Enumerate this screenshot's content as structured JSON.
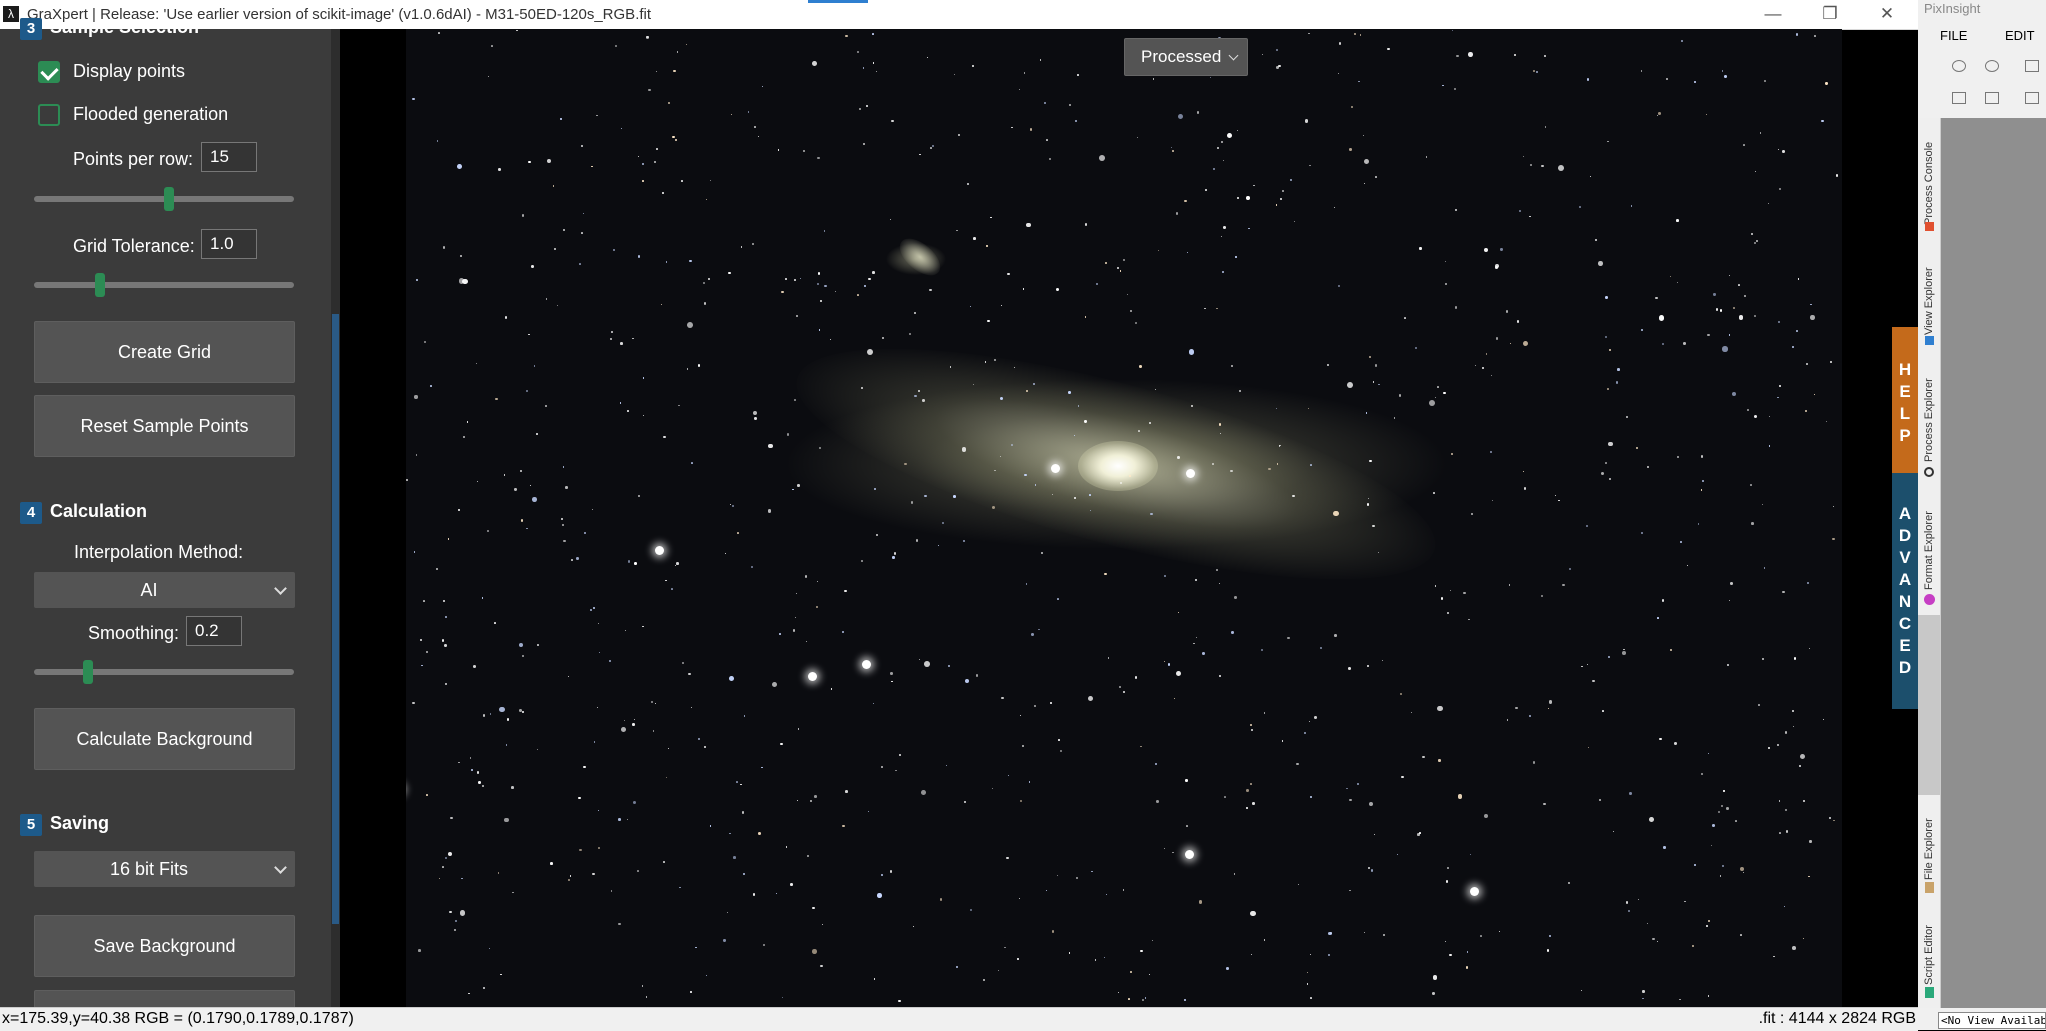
{
  "titlebar": {
    "title": "GraXpert | Release: 'Use earlier version of scikit-image' (v1.0.6dAI) - M31-50ED-120s_RGB.fit",
    "minimize": "—",
    "maximize": "❐",
    "close": "✕"
  },
  "sample_selection": {
    "section_number": "3",
    "title": "Sample Selection",
    "display_points_label": "Display points",
    "display_points_checked": true,
    "flooded_generation_label": "Flooded generation",
    "flooded_generation_checked": false,
    "points_per_row_label": "Points per row:",
    "points_per_row_value": "15",
    "grid_tolerance_label": "Grid Tolerance:",
    "grid_tolerance_value": "1.0",
    "create_grid_label": "Create Grid",
    "reset_label": "Reset Sample Points"
  },
  "calculation": {
    "section_number": "4",
    "title": "Calculation",
    "interpolation_label": "Interpolation Method:",
    "interpolation_value": "AI",
    "smoothing_label": "Smoothing:",
    "smoothing_value": "0.2",
    "calculate_label": "Calculate Background"
  },
  "saving": {
    "section_number": "5",
    "title": "Saving",
    "format_value": "16 bit Fits",
    "save_label": "Save Background"
  },
  "image": {
    "view_mode": "Processed"
  },
  "side_tabs": {
    "help": "HELP",
    "advanced": "ADVANCED"
  },
  "pixinsight": {
    "title": "PixInsight",
    "menu_file": "FILE",
    "menu_edit": "EDIT",
    "tabs": [
      "Process Console",
      "View Explorer",
      "Process Explorer",
      "Format Explorer",
      "File Explorer",
      "Script Editor"
    ],
    "no_view": "<No View Available>"
  },
  "status": {
    "coords": "x=175.39,y=40.38  RGB = (0.1790,0.1789,0.1787)",
    "info": ".fit : 4144 x 2824 RGB"
  },
  "colors": {
    "sidebar_bg": "#3b3b3b",
    "accent_green": "#2c8c54",
    "section_blue": "#1d5a8a",
    "help_orange": "#c46a1b",
    "advanced_blue": "#1c4f6c"
  }
}
